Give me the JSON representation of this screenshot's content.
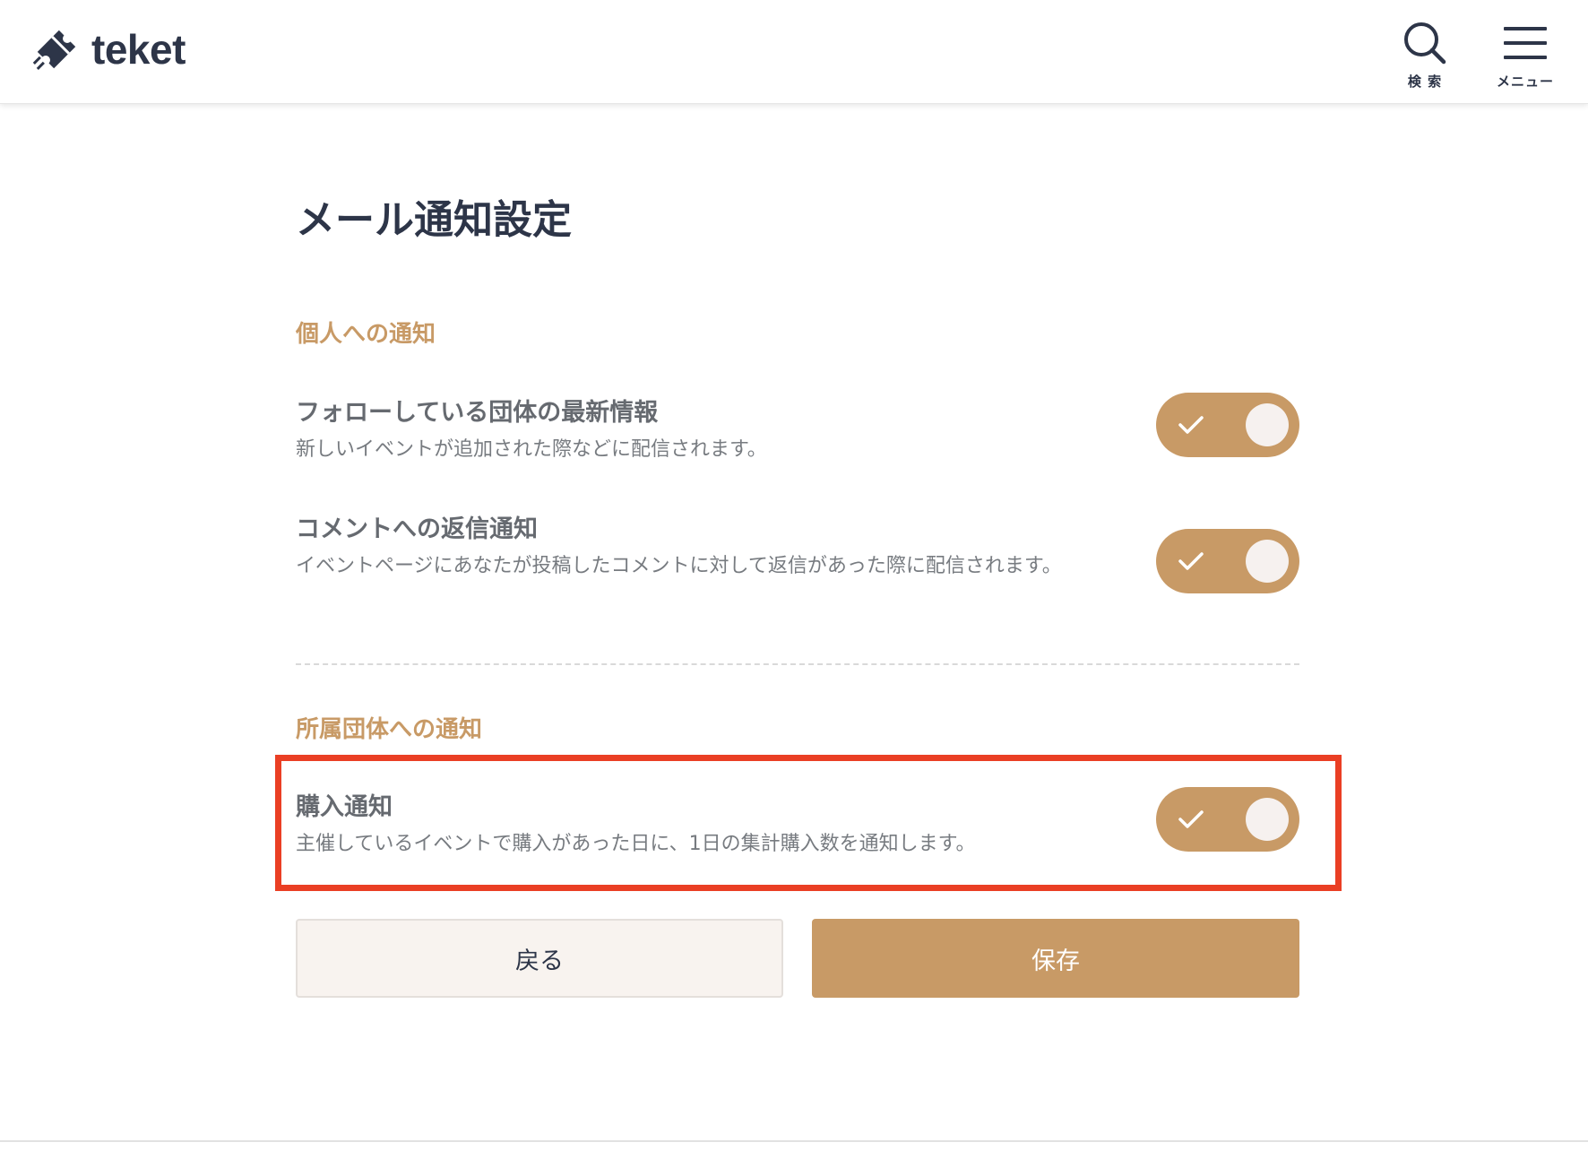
{
  "header": {
    "logo_text": "teket",
    "search_label": "検 索",
    "menu_label": "メニュー"
  },
  "page": {
    "title": "メール通知設定"
  },
  "sections": [
    {
      "title": "個人への通知",
      "items": [
        {
          "title": "フォローしている団体の最新情報",
          "desc": "新しいイベントが追加された際などに配信されます。",
          "enabled": true
        },
        {
          "title": "コメントへの返信通知",
          "desc": "イベントページにあなたが投稿したコメントに対して返信があった際に配信されます。",
          "enabled": true
        }
      ]
    },
    {
      "title": "所属団体への通知",
      "items": [
        {
          "title": "購入通知",
          "desc": "主催しているイベントで購入があった日に、1日の集計購入数を通知します。",
          "enabled": true
        }
      ]
    }
  ],
  "buttons": {
    "back_label": "戻る",
    "save_label": "保存"
  },
  "colors": {
    "accent": "#c89a66",
    "text_dark": "#2d3548",
    "highlight": "#ea3f24"
  }
}
